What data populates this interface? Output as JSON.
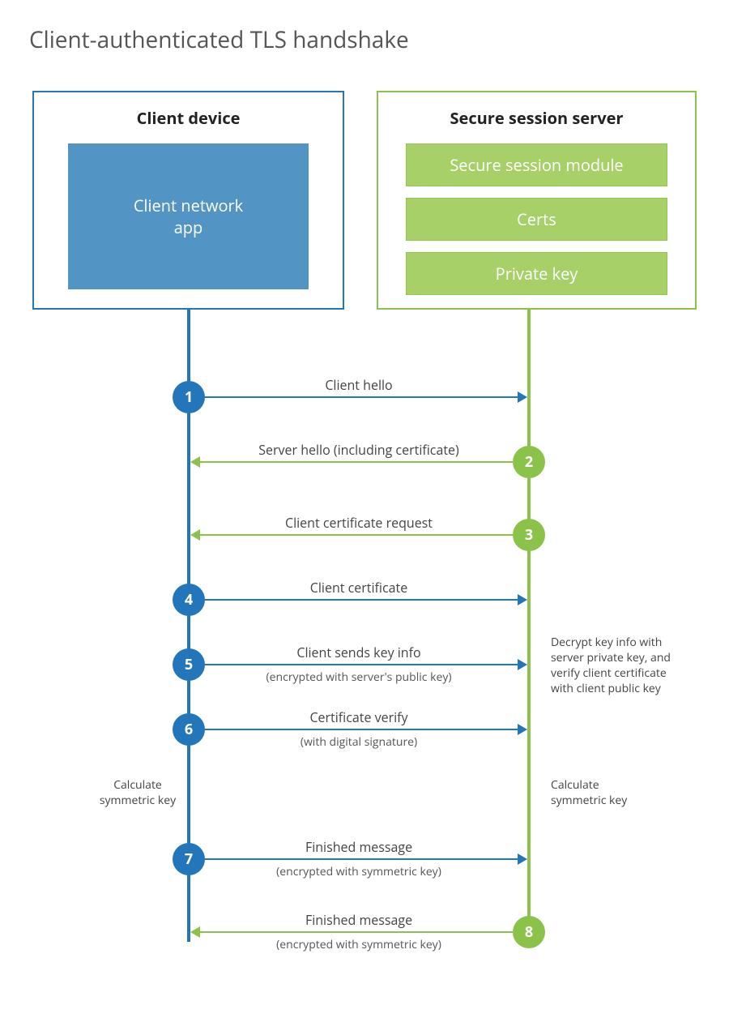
{
  "title": "Client-authenticated TLS handshake",
  "client_box": {
    "title": "Client device",
    "app_label": "Client network\napp"
  },
  "server_box": {
    "title": "Secure session server",
    "modules": [
      "Secure session module",
      "Certs",
      "Private key"
    ]
  },
  "steps": {
    "s1": {
      "num": "1",
      "label": "Client hello"
    },
    "s2": {
      "num": "2",
      "label": "Server hello (including certificate)"
    },
    "s3": {
      "num": "3",
      "label": "Client certificate request"
    },
    "s4": {
      "num": "4",
      "label": "Client certificate"
    },
    "s5": {
      "num": "5",
      "label": "Client sends key info",
      "sub": "(encrypted with server's public key)"
    },
    "s6": {
      "num": "6",
      "label": "Certificate verify",
      "sub": "(with digital signature)"
    },
    "s7": {
      "num": "7",
      "label": "Finished message",
      "sub": "(encrypted with symmetric key)"
    },
    "s8": {
      "num": "8",
      "label": "Finished message",
      "sub": "(encrypted with symmetric key)"
    }
  },
  "notes": {
    "server_decrypt": "Decrypt key info with\nserver private key, and\nverify client certificate\nwith client public key",
    "client_calc": "Calculate\nsymmetric key",
    "server_calc": "Calculate\nsymmetric key"
  }
}
